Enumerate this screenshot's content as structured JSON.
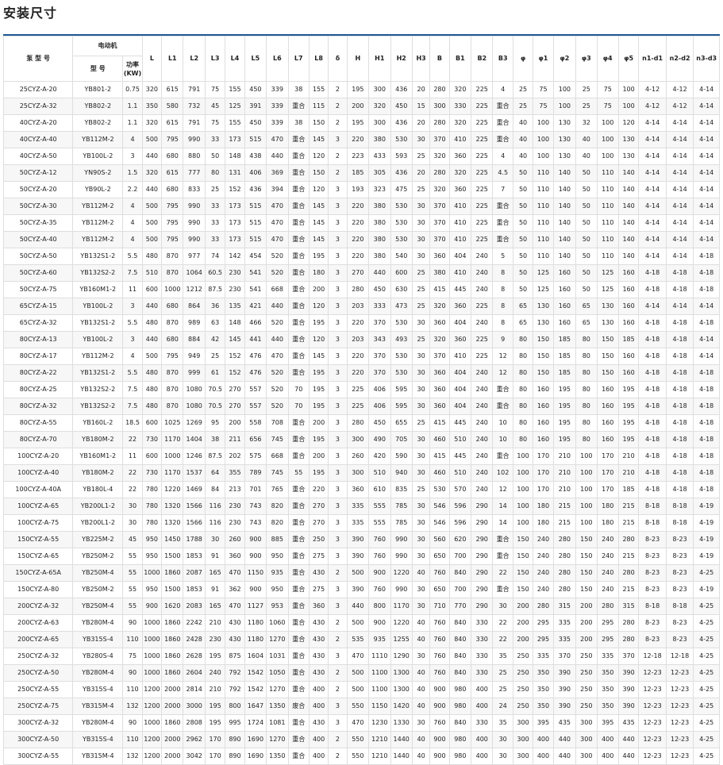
{
  "page_title": "安装尺寸",
  "header": {
    "pump_model": "泵 型 号",
    "motor_group": "电动机",
    "motor_model": "型 号",
    "power": "功率(KW)",
    "dims": [
      "L",
      "L1",
      "L2",
      "L3",
      "L4",
      "L5",
      "L6",
      "L7",
      "L8",
      "δ",
      "H",
      "H1",
      "H2",
      "H3",
      "B",
      "B1",
      "B2",
      "B3",
      "φ",
      "φ1",
      "φ2",
      "φ3",
      "φ4",
      "φ5",
      "n1-d1",
      "n2-d2",
      "n3-d3"
    ]
  },
  "rows": [
    [
      "25CYZ-A-20",
      "YB801-2",
      "0.75",
      "320",
      "615",
      "791",
      "75",
      "155",
      "450",
      "339",
      "38",
      "155",
      "2",
      "195",
      "300",
      "436",
      "20",
      "280",
      "320",
      "225",
      "4",
      "25",
      "75",
      "100",
      "25",
      "75",
      "100",
      "4-12",
      "4-12",
      "4-14"
    ],
    [
      "25CYZ-A-32",
      "YB802-2",
      "1.1",
      "350",
      "580",
      "732",
      "45",
      "125",
      "391",
      "339",
      "重合",
      "115",
      "2",
      "200",
      "320",
      "450",
      "15",
      "300",
      "330",
      "225",
      "重合",
      "25",
      "75",
      "100",
      "25",
      "75",
      "100",
      "4-12",
      "4-12",
      "4-14"
    ],
    [
      "40CYZ-A-20",
      "YB802-2",
      "1.1",
      "320",
      "615",
      "791",
      "75",
      "155",
      "450",
      "339",
      "38",
      "150",
      "2",
      "195",
      "300",
      "436",
      "20",
      "280",
      "320",
      "225",
      "重合",
      "40",
      "100",
      "130",
      "32",
      "100",
      "120",
      "4-14",
      "4-14",
      "4-14"
    ],
    [
      "40CYZ-A-40",
      "YB112M-2",
      "4",
      "500",
      "795",
      "990",
      "33",
      "173",
      "515",
      "470",
      "重合",
      "145",
      "3",
      "220",
      "380",
      "530",
      "30",
      "370",
      "410",
      "225",
      "重合",
      "40",
      "100",
      "130",
      "40",
      "100",
      "130",
      "4-14",
      "4-14",
      "4-14"
    ],
    [
      "40CYZ-A-50",
      "YB100L-2",
      "3",
      "440",
      "680",
      "880",
      "50",
      "148",
      "438",
      "440",
      "重合",
      "120",
      "2",
      "223",
      "433",
      "593",
      "25",
      "320",
      "360",
      "225",
      "4",
      "40",
      "100",
      "130",
      "40",
      "100",
      "130",
      "4-14",
      "4-14",
      "4-14"
    ],
    [
      "50CYZ-A-12",
      "YN90S-2",
      "1.5",
      "320",
      "615",
      "777",
      "80",
      "131",
      "406",
      "369",
      "重合",
      "150",
      "2",
      "185",
      "305",
      "436",
      "20",
      "280",
      "320",
      "225",
      "4.5",
      "50",
      "110",
      "140",
      "50",
      "110",
      "140",
      "4-14",
      "4-14",
      "4-14"
    ],
    [
      "50CYZ-A-20",
      "YB90L-2",
      "2.2",
      "440",
      "680",
      "833",
      "25",
      "152",
      "436",
      "394",
      "重合",
      "120",
      "3",
      "193",
      "323",
      "475",
      "25",
      "320",
      "360",
      "225",
      "7",
      "50",
      "110",
      "140",
      "50",
      "110",
      "140",
      "4-14",
      "4-14",
      "4-14"
    ],
    [
      "50CYZ-A-30",
      "YB112M-2",
      "4",
      "500",
      "795",
      "990",
      "33",
      "173",
      "515",
      "470",
      "重合",
      "145",
      "3",
      "220",
      "380",
      "530",
      "30",
      "370",
      "410",
      "225",
      "重合",
      "50",
      "110",
      "140",
      "50",
      "110",
      "140",
      "4-14",
      "4-14",
      "4-14"
    ],
    [
      "50CYZ-A-35",
      "YB112M-2",
      "4",
      "500",
      "795",
      "990",
      "33",
      "173",
      "515",
      "470",
      "重合",
      "145",
      "3",
      "220",
      "380",
      "530",
      "30",
      "370",
      "410",
      "225",
      "重合",
      "50",
      "110",
      "140",
      "50",
      "110",
      "140",
      "4-14",
      "4-14",
      "4-14"
    ],
    [
      "50CYZ-A-40",
      "YB112M-2",
      "4",
      "500",
      "795",
      "990",
      "33",
      "173",
      "515",
      "470",
      "重合",
      "145",
      "3",
      "220",
      "380",
      "530",
      "30",
      "370",
      "410",
      "225",
      "重合",
      "50",
      "110",
      "140",
      "50",
      "110",
      "140",
      "4-14",
      "4-14",
      "4-14"
    ],
    [
      "50CYZ-A-50",
      "YB132S1-2",
      "5.5",
      "480",
      "870",
      "977",
      "74",
      "142",
      "454",
      "520",
      "重合",
      "195",
      "3",
      "220",
      "380",
      "540",
      "30",
      "360",
      "404",
      "240",
      "5",
      "50",
      "110",
      "140",
      "50",
      "110",
      "140",
      "4-14",
      "4-14",
      "4-18"
    ],
    [
      "50CYZ-A-60",
      "YB132S2-2",
      "7.5",
      "510",
      "870",
      "1064",
      "60.5",
      "230",
      "541",
      "520",
      "重合",
      "180",
      "3",
      "270",
      "440",
      "600",
      "25",
      "380",
      "410",
      "240",
      "8",
      "50",
      "125",
      "160",
      "50",
      "125",
      "160",
      "4-18",
      "4-18",
      "4-18"
    ],
    [
      "50CYZ-A-75",
      "YB160M1-2",
      "11",
      "600",
      "1000",
      "1212",
      "87.5",
      "230",
      "541",
      "668",
      "重合",
      "200",
      "3",
      "280",
      "450",
      "630",
      "25",
      "415",
      "445",
      "240",
      "8",
      "50",
      "125",
      "160",
      "50",
      "125",
      "160",
      "4-18",
      "4-18",
      "4-18"
    ],
    [
      "65CYZ-A-15",
      "YB100L-2",
      "3",
      "440",
      "680",
      "864",
      "36",
      "135",
      "421",
      "440",
      "重合",
      "120",
      "3",
      "203",
      "333",
      "473",
      "25",
      "320",
      "360",
      "225",
      "8",
      "65",
      "130",
      "160",
      "65",
      "130",
      "160",
      "4-14",
      "4-14",
      "4-14"
    ],
    [
      "65CYZ-A-32",
      "YB132S1-2",
      "5.5",
      "480",
      "870",
      "989",
      "63",
      "148",
      "466",
      "520",
      "重合",
      "195",
      "3",
      "220",
      "370",
      "530",
      "30",
      "360",
      "404",
      "240",
      "8",
      "65",
      "130",
      "160",
      "65",
      "130",
      "160",
      "4-18",
      "4-18",
      "4-18"
    ],
    [
      "80CYZ-A-13",
      "YB100L-2",
      "3",
      "440",
      "680",
      "884",
      "42",
      "145",
      "441",
      "440",
      "重合",
      "120",
      "3",
      "203",
      "343",
      "493",
      "25",
      "320",
      "360",
      "225",
      "9",
      "80",
      "150",
      "185",
      "80",
      "150",
      "185",
      "4-18",
      "4-18",
      "4-14"
    ],
    [
      "80CYZ-A-17",
      "YB112M-2",
      "4",
      "500",
      "795",
      "949",
      "25",
      "152",
      "476",
      "470",
      "重合",
      "145",
      "3",
      "220",
      "370",
      "530",
      "30",
      "370",
      "410",
      "225",
      "12",
      "80",
      "150",
      "185",
      "80",
      "150",
      "160",
      "4-18",
      "4-18",
      "4-14"
    ],
    [
      "80CYZ-A-22",
      "YB132S1-2",
      "5.5",
      "480",
      "870",
      "999",
      "61",
      "152",
      "476",
      "520",
      "重合",
      "195",
      "3",
      "220",
      "370",
      "530",
      "30",
      "360",
      "404",
      "240",
      "12",
      "80",
      "150",
      "185",
      "80",
      "150",
      "160",
      "4-18",
      "4-18",
      "4-18"
    ],
    [
      "80CYZ-A-25",
      "YB132S2-2",
      "7.5",
      "480",
      "870",
      "1080",
      "70.5",
      "270",
      "557",
      "520",
      "70",
      "195",
      "3",
      "225",
      "406",
      "595",
      "30",
      "360",
      "404",
      "240",
      "重合",
      "80",
      "160",
      "195",
      "80",
      "160",
      "195",
      "4-18",
      "4-18",
      "4-18"
    ],
    [
      "80CYZ-A-32",
      "YB132S2-2",
      "7.5",
      "480",
      "870",
      "1080",
      "70.5",
      "270",
      "557",
      "520",
      "70",
      "195",
      "3",
      "225",
      "406",
      "595",
      "30",
      "360",
      "404",
      "240",
      "重合",
      "80",
      "160",
      "195",
      "80",
      "160",
      "195",
      "4-18",
      "4-18",
      "4-18"
    ],
    [
      "80CYZ-A-55",
      "YB160L-2",
      "18.5",
      "600",
      "1025",
      "1269",
      "95",
      "200",
      "558",
      "708",
      "重合",
      "200",
      "3",
      "280",
      "450",
      "655",
      "25",
      "415",
      "445",
      "240",
      "10",
      "80",
      "160",
      "195",
      "80",
      "160",
      "195",
      "4-18",
      "4-18",
      "4-18"
    ],
    [
      "80CYZ-A-70",
      "YB180M-2",
      "22",
      "730",
      "1170",
      "1404",
      "38",
      "211",
      "656",
      "745",
      "重合",
      "195",
      "3",
      "300",
      "490",
      "705",
      "30",
      "460",
      "510",
      "240",
      "10",
      "80",
      "160",
      "195",
      "80",
      "160",
      "195",
      "4-18",
      "4-18",
      "4-18"
    ],
    [
      "100CYZ-A-20",
      "YB160M1-2",
      "11",
      "600",
      "1000",
      "1246",
      "87.5",
      "202",
      "575",
      "668",
      "重合",
      "200",
      "3",
      "260",
      "420",
      "590",
      "30",
      "415",
      "445",
      "240",
      "重合",
      "100",
      "170",
      "210",
      "100",
      "170",
      "210",
      "4-18",
      "4-18",
      "4-18"
    ],
    [
      "100CYZ-A-40",
      "YB180M-2",
      "22",
      "730",
      "1170",
      "1537",
      "64",
      "355",
      "789",
      "745",
      "55",
      "195",
      "3",
      "300",
      "510",
      "940",
      "30",
      "460",
      "510",
      "240",
      "102",
      "100",
      "170",
      "210",
      "100",
      "170",
      "210",
      "4-18",
      "4-18",
      "4-18"
    ],
    [
      "100CYZ-A-40A",
      "YB180L-4",
      "22",
      "780",
      "1220",
      "1469",
      "84",
      "213",
      "701",
      "765",
      "重合",
      "220",
      "3",
      "360",
      "610",
      "835",
      "25",
      "530",
      "570",
      "240",
      "12",
      "100",
      "170",
      "210",
      "100",
      "170",
      "185",
      "4-18",
      "4-18",
      "4-18"
    ],
    [
      "100CYZ-A-65",
      "YB200L1-2",
      "30",
      "780",
      "1320",
      "1566",
      "116",
      "230",
      "743",
      "820",
      "重合",
      "270",
      "3",
      "335",
      "555",
      "785",
      "30",
      "546",
      "596",
      "290",
      "14",
      "100",
      "180",
      "215",
      "100",
      "180",
      "215",
      "8-18",
      "8-18",
      "4-19"
    ],
    [
      "100CYZ-A-75",
      "YB200L1-2",
      "30",
      "780",
      "1320",
      "1566",
      "116",
      "230",
      "743",
      "820",
      "重合",
      "270",
      "3",
      "335",
      "555",
      "785",
      "30",
      "546",
      "596",
      "290",
      "14",
      "100",
      "180",
      "215",
      "100",
      "180",
      "215",
      "8-18",
      "8-18",
      "4-19"
    ],
    [
      "150CYZ-A-55",
      "YB225M-2",
      "45",
      "950",
      "1450",
      "1788",
      "30",
      "260",
      "900",
      "885",
      "重合",
      "250",
      "3",
      "390",
      "760",
      "990",
      "30",
      "560",
      "620",
      "290",
      "重合",
      "150",
      "240",
      "280",
      "150",
      "240",
      "280",
      "8-23",
      "8-23",
      "4-19"
    ],
    [
      "150CYZ-A-65",
      "YB250M-2",
      "55",
      "950",
      "1500",
      "1853",
      "91",
      "360",
      "900",
      "950",
      "重合",
      "275",
      "3",
      "390",
      "760",
      "990",
      "30",
      "650",
      "700",
      "290",
      "重合",
      "150",
      "240",
      "280",
      "150",
      "240",
      "215",
      "8-23",
      "8-23",
      "4-19"
    ],
    [
      "150CYZ-A-65A",
      "YB250M-4",
      "55",
      "1000",
      "1860",
      "2087",
      "165",
      "470",
      "1150",
      "935",
      "重合",
      "430",
      "2",
      "500",
      "900",
      "1220",
      "40",
      "760",
      "840",
      "290",
      "22",
      "150",
      "240",
      "280",
      "150",
      "240",
      "280",
      "8-23",
      "8-23",
      "4-25"
    ],
    [
      "150CYZ-A-80",
      "YB250M-2",
      "55",
      "950",
      "1500",
      "1853",
      "91",
      "362",
      "900",
      "950",
      "重合",
      "275",
      "3",
      "390",
      "760",
      "990",
      "30",
      "650",
      "700",
      "290",
      "重合",
      "150",
      "240",
      "280",
      "150",
      "240",
      "215",
      "8-23",
      "8-23",
      "4-19"
    ],
    [
      "200CYZ-A-32",
      "YB250M-4",
      "55",
      "900",
      "1620",
      "2083",
      "165",
      "470",
      "1127",
      "953",
      "重合",
      "360",
      "3",
      "440",
      "800",
      "1170",
      "30",
      "710",
      "770",
      "290",
      "30",
      "200",
      "280",
      "315",
      "200",
      "280",
      "315",
      "8-18",
      "8-18",
      "4-25"
    ],
    [
      "200CYZ-A-63",
      "YB280M-4",
      "90",
      "1000",
      "1860",
      "2242",
      "210",
      "430",
      "1180",
      "1060",
      "重合",
      "430",
      "2",
      "500",
      "900",
      "1220",
      "40",
      "760",
      "840",
      "330",
      "22",
      "200",
      "295",
      "335",
      "200",
      "295",
      "280",
      "8-23",
      "8-23",
      "4-25"
    ],
    [
      "200CYZ-A-65",
      "YB315S-4",
      "110",
      "1000",
      "1860",
      "2428",
      "230",
      "430",
      "1180",
      "1270",
      "重合",
      "430",
      "2",
      "535",
      "935",
      "1255",
      "40",
      "760",
      "840",
      "330",
      "22",
      "200",
      "295",
      "335",
      "200",
      "295",
      "280",
      "8-23",
      "8-23",
      "4-25"
    ],
    [
      "250CYZ-A-32",
      "YB280S-4",
      "75",
      "1000",
      "1860",
      "2628",
      "195",
      "875",
      "1604",
      "1031",
      "重合",
      "430",
      "3",
      "470",
      "1110",
      "1290",
      "30",
      "760",
      "840",
      "330",
      "35",
      "250",
      "335",
      "370",
      "250",
      "335",
      "370",
      "12-18",
      "12-18",
      "4-25"
    ],
    [
      "250CYZ-A-50",
      "YB280M-4",
      "90",
      "1000",
      "1860",
      "2604",
      "240",
      "792",
      "1542",
      "1050",
      "重合",
      "430",
      "2",
      "500",
      "1100",
      "1300",
      "40",
      "760",
      "840",
      "330",
      "25",
      "250",
      "350",
      "390",
      "250",
      "350",
      "390",
      "12-23",
      "12-23",
      "4-25"
    ],
    [
      "250CYZ-A-55",
      "YB315S-4",
      "110",
      "1200",
      "2000",
      "2814",
      "210",
      "792",
      "1542",
      "1270",
      "重合",
      "400",
      "2",
      "500",
      "1100",
      "1300",
      "40",
      "900",
      "980",
      "400",
      "25",
      "250",
      "350",
      "390",
      "250",
      "350",
      "390",
      "12-23",
      "12-23",
      "4-25"
    ],
    [
      "250CYZ-A-75",
      "YB315M-4",
      "132",
      "1200",
      "2000",
      "3000",
      "195",
      "800",
      "1647",
      "1350",
      "废合",
      "400",
      "3",
      "550",
      "1150",
      "1420",
      "40",
      "900",
      "980",
      "400",
      "24",
      "250",
      "350",
      "390",
      "250",
      "350",
      "390",
      "12-23",
      "12-23",
      "4-25"
    ],
    [
      "300CYZ-A-32",
      "YB280M-4",
      "90",
      "1000",
      "1860",
      "2808",
      "195",
      "995",
      "1724",
      "1081",
      "重合",
      "430",
      "3",
      "470",
      "1230",
      "1330",
      "30",
      "760",
      "840",
      "330",
      "35",
      "300",
      "395",
      "435",
      "300",
      "395",
      "435",
      "12-23",
      "12-23",
      "4-25"
    ],
    [
      "300CYZ-A-50",
      "YB315S-4",
      "110",
      "1200",
      "2000",
      "2962",
      "170",
      "890",
      "1690",
      "1270",
      "重合",
      "400",
      "2",
      "550",
      "1210",
      "1440",
      "40",
      "900",
      "980",
      "400",
      "30",
      "300",
      "400",
      "440",
      "300",
      "400",
      "440",
      "12-23",
      "12-23",
      "4-25"
    ],
    [
      "300CYZ-A-55",
      "YB315M-4",
      "132",
      "1200",
      "2000",
      "3042",
      "170",
      "890",
      "1690",
      "1350",
      "重合",
      "400",
      "2",
      "550",
      "1210",
      "1440",
      "40",
      "900",
      "980",
      "400",
      "30",
      "300",
      "400",
      "440",
      "300",
      "400",
      "440",
      "12-23",
      "12-23",
      "4-25"
    ]
  ]
}
